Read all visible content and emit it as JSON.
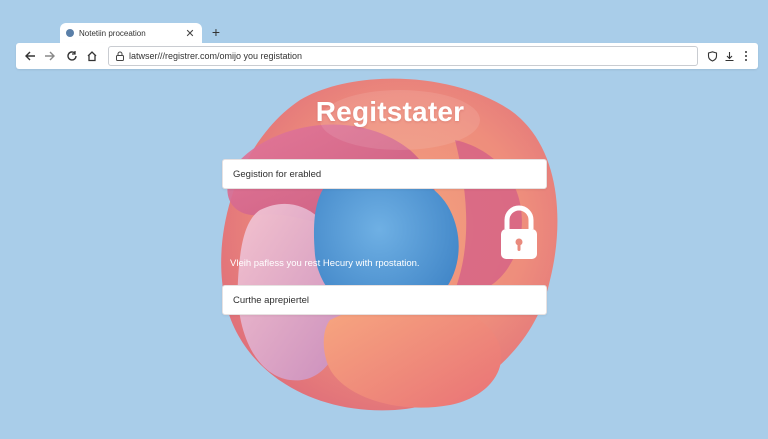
{
  "browser": {
    "tab": {
      "title": "Notetiin proceation"
    },
    "address_bar": {
      "url": "latwser///registrer.com/omijo you registation"
    }
  },
  "page": {
    "title": "Regitstater",
    "field_1": {
      "value": "Gegistion for erabled"
    },
    "description": "Vleih pafless you rest Hecury with rpostation.",
    "field_2": {
      "value": "Curthe aprepiertel"
    }
  },
  "colors": {
    "background": "#a9cde9",
    "blob_coral": "#ef8a7d",
    "blob_pink": "#d0648a",
    "blob_blue": "#4f98d2",
    "field_bg": "#ffffff"
  },
  "icons": [
    "back-arrow-icon",
    "forward-arrow-icon",
    "reload-icon",
    "home-icon",
    "lock-icon",
    "shield-icon",
    "download-icon",
    "menu-dots-icon",
    "padlock-icon"
  ]
}
